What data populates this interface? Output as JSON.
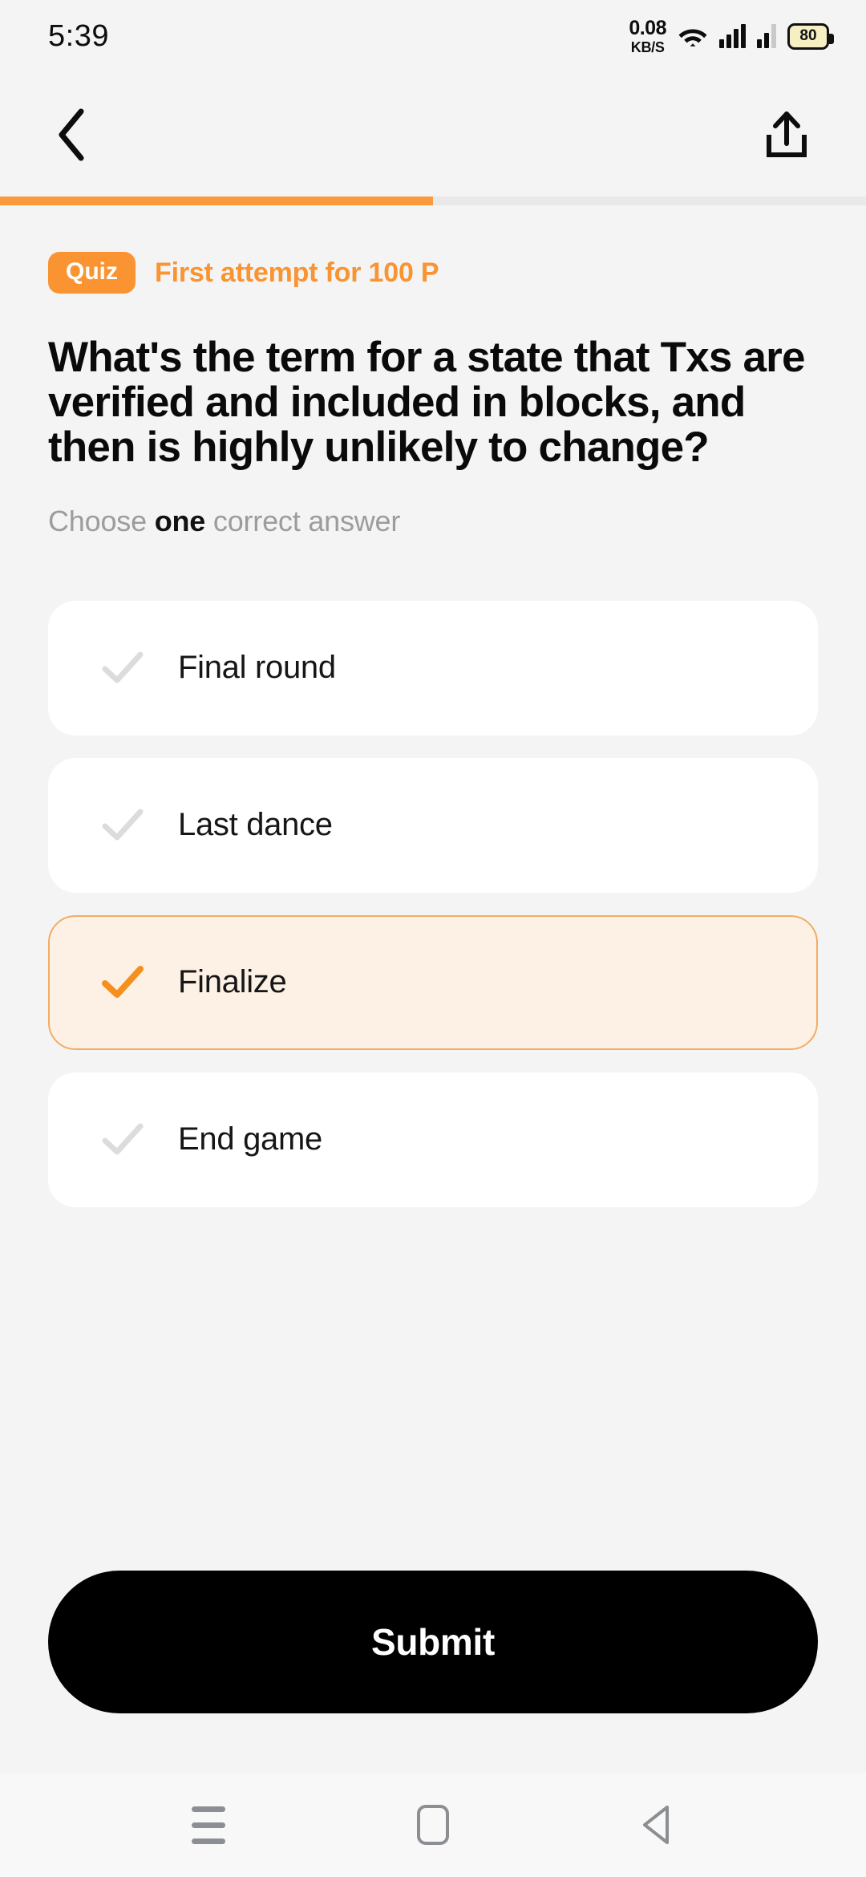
{
  "status_bar": {
    "time": "5:39",
    "net_speed_value": "0.08",
    "net_speed_unit": "KB/S",
    "wifi_icon": "wifi-icon",
    "signal_icon_1": "signal-bars-icon",
    "signal_icon_2": "signal-bars-secondary-icon",
    "battery_level": "80"
  },
  "app_bar": {
    "back_icon": "chevron-left-icon",
    "share_icon": "share-upload-icon"
  },
  "progress": {
    "percent": 50,
    "fill_color": "#FB9A3C",
    "track_color": "#E9E9E9"
  },
  "quiz": {
    "badge_label": "Quiz",
    "attempt_text": "First attempt for 100 P",
    "accent_color": "#FA9432",
    "question": "What's the term for a state that Txs are verified and included in blocks, and then is highly unlikely to change?",
    "instruction_prefix": "Choose ",
    "instruction_emphasis": "one",
    "instruction_suffix": " correct answer",
    "options": [
      {
        "label": "Final round",
        "selected": false,
        "check_icon": "check-icon"
      },
      {
        "label": "Last dance",
        "selected": false,
        "check_icon": "check-icon"
      },
      {
        "label": "Finalize",
        "selected": true,
        "check_icon": "check-icon-selected"
      },
      {
        "label": "End game",
        "selected": false,
        "check_icon": "check-icon"
      }
    ],
    "submit_label": "Submit"
  },
  "nav_bar": {
    "recents_icon": "recents-menu-icon",
    "home_icon": "home-square-icon",
    "back_icon": "back-triangle-icon"
  }
}
